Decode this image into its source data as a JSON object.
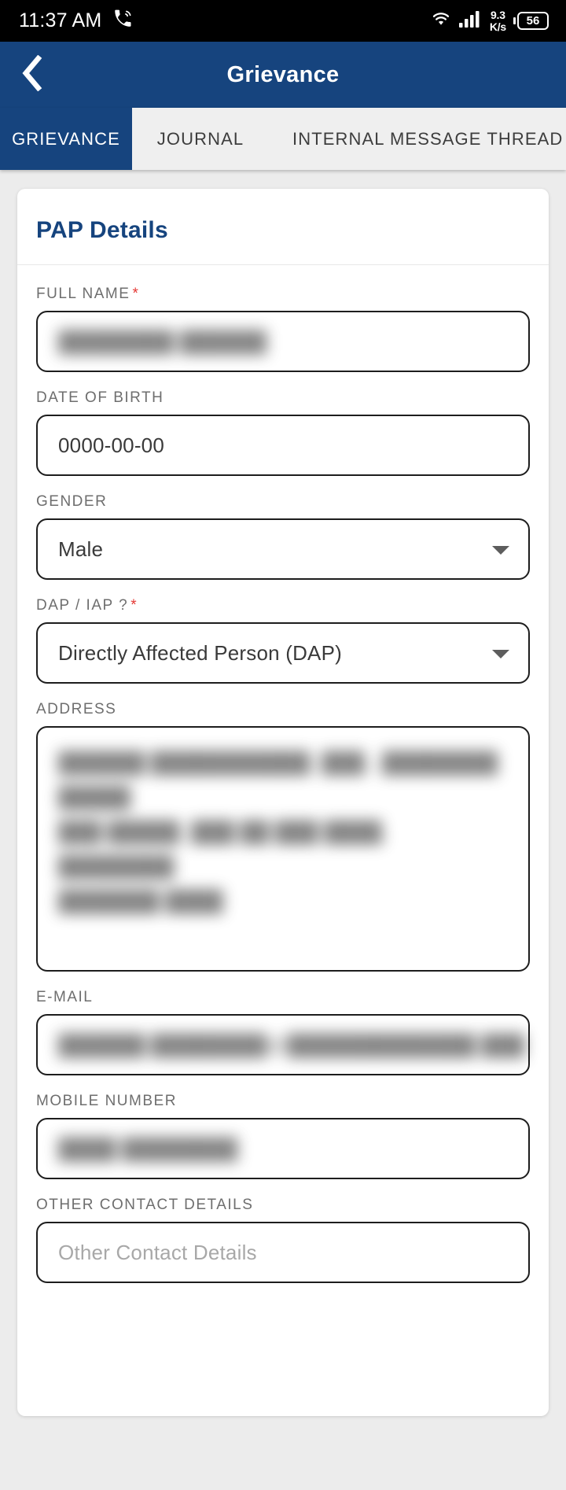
{
  "status_bar": {
    "time": "11:37 AM",
    "phone_icon": "phone-call-icon",
    "wifi_icon": "wifi-icon",
    "signal_icon": "cellular-signal-icon",
    "net_speed_value": "9.3",
    "net_speed_unit": "K/s",
    "battery_level": "56"
  },
  "app_bar": {
    "back_icon": "back-chevron-icon",
    "title": "Grievance"
  },
  "tabs": [
    {
      "label": "GRIEVANCE",
      "active": true
    },
    {
      "label": "JOURNAL",
      "active": false
    },
    {
      "label": "INTERNAL MESSAGE THREAD",
      "active": false
    }
  ],
  "card": {
    "title": "PAP Details",
    "fields": [
      {
        "label": "FULL NAME",
        "required": true,
        "type": "text",
        "value": "████████ ██████",
        "redacted": true
      },
      {
        "label": "DATE OF BIRTH",
        "required": false,
        "type": "text",
        "value": "0000-00-00",
        "redacted": false
      },
      {
        "label": "GENDER",
        "required": false,
        "type": "select",
        "value": "Male",
        "redacted": false
      },
      {
        "label": "DAP / IAP ?",
        "required": true,
        "type": "select",
        "value": "Directly Affected Person (DAP)",
        "redacted": false
      },
      {
        "label": "ADDRESS",
        "required": false,
        "type": "textarea",
        "value": "██████ ███████████, ███., ████████ █████\n███ █████, ███ ██ ███ ████, ████████\n███████ ████",
        "redacted": true
      },
      {
        "label": "E-MAIL",
        "required": false,
        "type": "text",
        "value": "██████.████████@█████████████.███",
        "redacted": true
      },
      {
        "label": "MOBILE NUMBER",
        "required": false,
        "type": "text",
        "value": "████ ████████",
        "redacted": true
      },
      {
        "label": "OTHER CONTACT DETAILS",
        "required": false,
        "type": "text",
        "value": "",
        "placeholder": "Other Contact Details",
        "redacted": false
      }
    ]
  },
  "colors": {
    "brand_blue": "#16447e",
    "required_red": "#e53935",
    "page_bg": "#ececec",
    "tab_inactive_bg": "#efefef"
  }
}
